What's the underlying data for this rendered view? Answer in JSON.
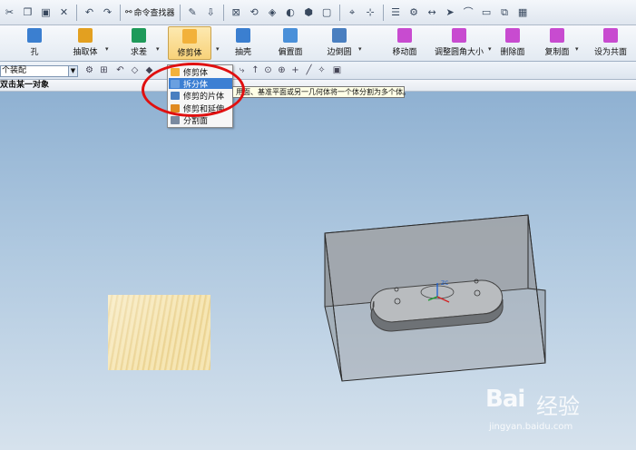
{
  "toolbar_top": {
    "command_finder_label": "命令查找器"
  },
  "ribbon": {
    "buttons": [
      {
        "label": "孔",
        "color": "#3b7fd0"
      },
      {
        "label": "抽取体",
        "color": "#e3a020"
      },
      {
        "label": "求差",
        "color": "#1f9a5a"
      },
      {
        "label": "修剪体",
        "color": "#f2b13a"
      },
      {
        "label": "抽壳",
        "color": "#3b7fd0"
      },
      {
        "label": "偏置面",
        "color": "#4a90d9"
      },
      {
        "label": "边倒圆",
        "color": "#4a7fc0"
      },
      {
        "label": "移动面",
        "color": "#c84bd0"
      },
      {
        "label": "调整圆角大小",
        "color": "#c84bd0"
      },
      {
        "label": "删除面",
        "color": "#c84bd0"
      },
      {
        "label": "复制面",
        "color": "#c84bd0"
      },
      {
        "label": "设为共面",
        "color": "#c84bd0"
      }
    ]
  },
  "selection_bar": {
    "filter_value": "个装配"
  },
  "cue_line": {
    "text": "双击某一对象"
  },
  "dropdown_menu": {
    "items": [
      {
        "label": "修剪体",
        "icon": "trim-body-icon",
        "color": "#f2b13a"
      },
      {
        "label": "拆分体",
        "icon": "split-body-icon",
        "color": "#6aa0e0"
      },
      {
        "label": "修剪的片体",
        "icon": "trimmed-sheet-icon",
        "color": "#4a7fc0"
      },
      {
        "label": "修剪和延伸",
        "icon": "trim-extend-icon",
        "color": "#e08a20"
      },
      {
        "label": "分割面",
        "icon": "divide-face-icon",
        "color": "#7a8aa0"
      }
    ],
    "selected_index": 1
  },
  "tooltip": {
    "text": "用面、基准平面或另一几何体将一个体分割为多个体。"
  },
  "scene": {
    "csys_label": "ZC"
  },
  "watermark": {
    "brand": "Bai",
    "brand_suffix": "经验",
    "url": "jingyan.baidu.com"
  }
}
